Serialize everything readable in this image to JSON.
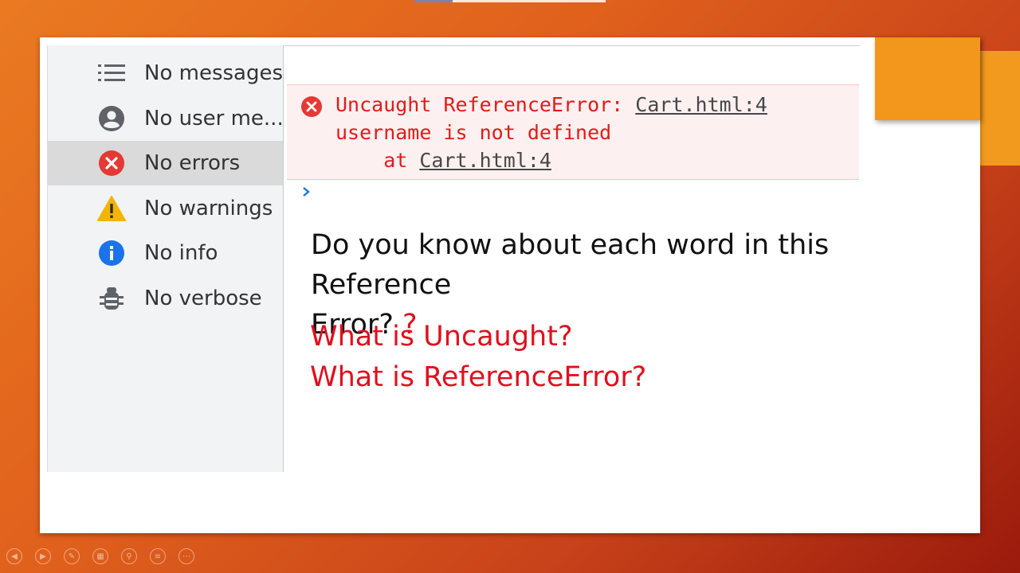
{
  "sidebar": {
    "items": [
      {
        "label": "No messages",
        "icon": "list-icon",
        "selected": false
      },
      {
        "label": "No user me...",
        "icon": "user-icon",
        "selected": false
      },
      {
        "label": "No errors",
        "icon": "error-icon",
        "selected": true
      },
      {
        "label": "No warnings",
        "icon": "warning-icon",
        "selected": false
      },
      {
        "label": "No info",
        "icon": "info-icon",
        "selected": false
      },
      {
        "label": "No verbose",
        "icon": "bug-icon",
        "selected": false
      }
    ]
  },
  "console": {
    "error": {
      "line1": "Uncaught ReferenceError: ",
      "link1": "Cart.html:4",
      "line2": "username is not defined",
      "line3_prefix": "    at ",
      "link2": "Cart.html:4"
    },
    "prompt_icon": "chevron-right-icon"
  },
  "slide": {
    "question_line1": "Do you know about each word in this Reference",
    "question_line2": "Error?",
    "question_mark": "?",
    "q1": "What is Uncaught?",
    "q2": "What is ReferenceError?"
  },
  "colors": {
    "error_red": "#e21b1b",
    "slide_red": "#e0101e",
    "accent_orange": "#f3961c",
    "icon_gray": "#5f6368",
    "warning_yellow": "#f4b400",
    "info_blue": "#1a73e8"
  },
  "controls": [
    "previous-icon",
    "next-icon",
    "pen-icon",
    "slides-icon",
    "zoom-icon",
    "subtitles-icon",
    "more-icon"
  ]
}
